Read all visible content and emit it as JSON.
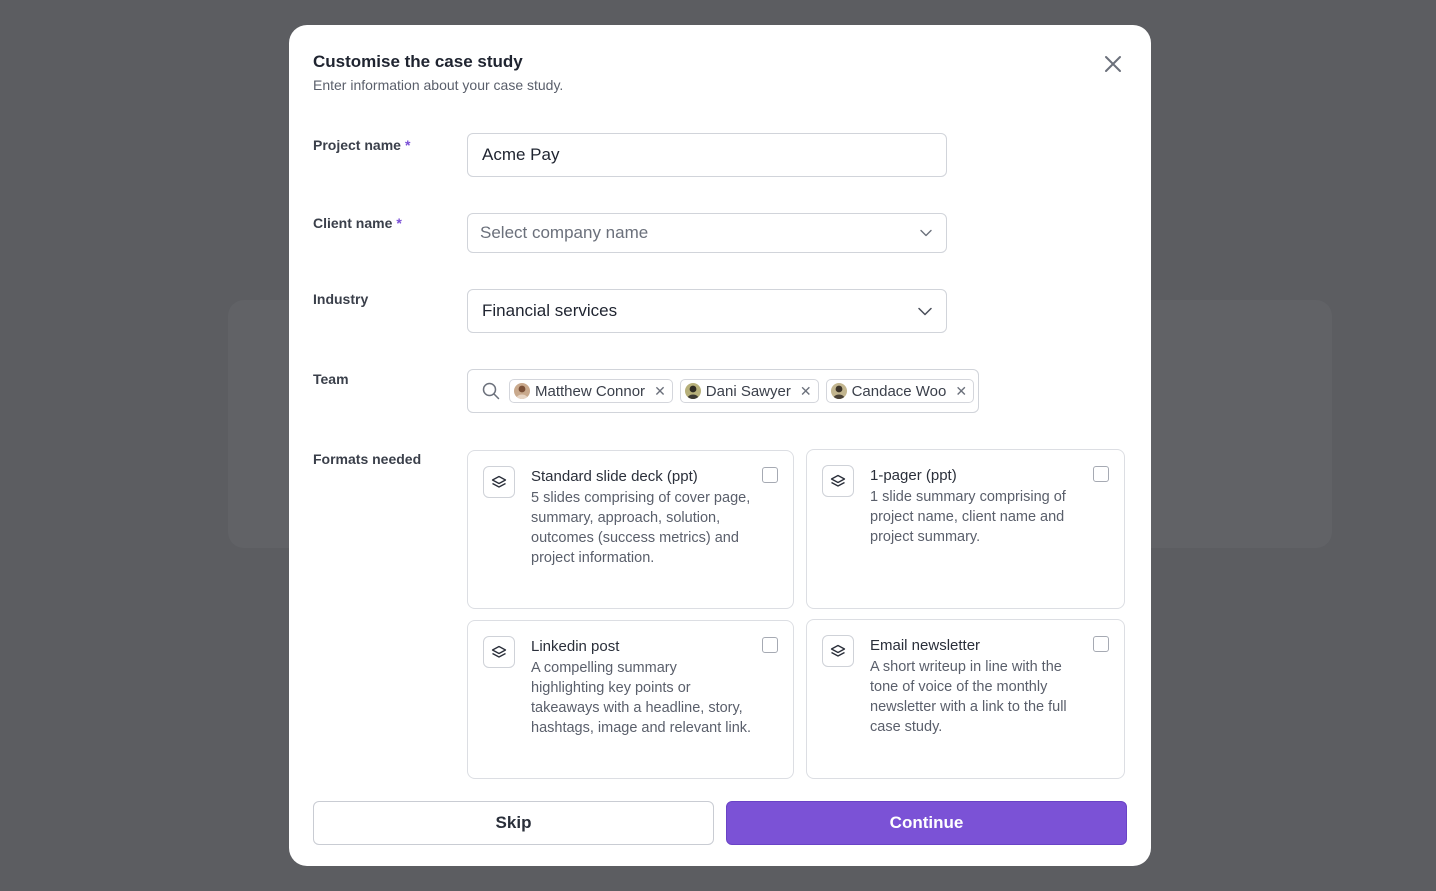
{
  "modal": {
    "title": "Customise the case study",
    "subtitle": "Enter information about your case study."
  },
  "fields": {
    "project_name": {
      "label": "Project name",
      "required_mark": "*",
      "value": "Acme Pay"
    },
    "client_name": {
      "label": "Client name",
      "required_mark": "*",
      "placeholder": "Select company name"
    },
    "industry": {
      "label": "Industry",
      "value": "Financial services"
    },
    "team": {
      "label": "Team",
      "members": [
        {
          "name": "Matthew Connor"
        },
        {
          "name": "Dani Sawyer"
        },
        {
          "name": "Candace Woo"
        }
      ]
    },
    "formats": {
      "label": "Formats needed",
      "options": [
        {
          "title": "Standard slide deck (ppt)",
          "description_lines": [
            "5 slides comprising of cover page,",
            "summary, approach, solution,",
            "outcomes (success metrics) and",
            "project information."
          ],
          "checked": false
        },
        {
          "title": "1-pager (ppt)",
          "description_lines": [
            "1 slide summary comprising of",
            "project name, client name and",
            "project summary."
          ],
          "checked": false
        },
        {
          "title": "Linkedin post",
          "description_lines": [
            "A compelling summary",
            "highlighting key points or",
            "takeaways with a headline, story,",
            "hashtags, image and relevant link."
          ],
          "checked": false
        },
        {
          "title": "Email newsletter",
          "description_lines": [
            "A short writeup in line with the",
            "tone of voice of the monthly",
            "newsletter with a link to the full",
            "case study."
          ],
          "checked": false
        }
      ]
    }
  },
  "actions": {
    "skip_label": "Skip",
    "continue_label": "Continue"
  },
  "colors": {
    "accent": "#7b52d6",
    "overlay": "#5c5d61"
  }
}
